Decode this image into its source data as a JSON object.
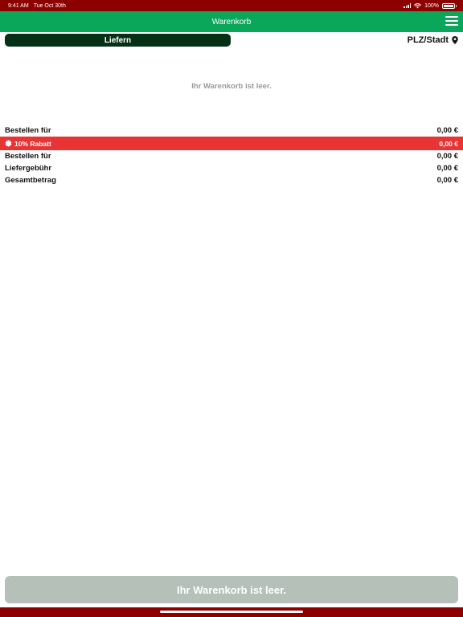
{
  "status_bar": {
    "time": "9:41 AM",
    "date": "Tue Oct 30th",
    "battery": "100%"
  },
  "header": {
    "title": "Warenkorb",
    "menu_icon": "hamburger-menu-icon"
  },
  "delivery": {
    "mode_label": "Liefern",
    "location_label": "PLZ/Stadt",
    "location_icon": "map-pin-icon"
  },
  "cart": {
    "empty_message": "Ihr Warenkorb ist leer."
  },
  "summary": {
    "order_for_1_label": "Bestellen für",
    "order_for_1_value": "0,00 €",
    "discount_label": "10% Rabatt",
    "discount_value": "0,00 €",
    "discount_icon": "discount-badge-icon",
    "order_for_2_label": "Bestellen für",
    "order_for_2_value": "0,00 €",
    "delivery_fee_label": "Liefergebühr",
    "delivery_fee_value": "0,00 €",
    "total_label": "Gesamtbetrag",
    "total_value": "0,00 €"
  },
  "checkout": {
    "label": "Ihr Warenkorb ist leer."
  },
  "colors": {
    "status_bar": "#8c0000",
    "nav_bar": "#0aa65a",
    "deliver_button": "#053016",
    "discount_bar": "#e83434",
    "checkout_disabled": "#b5c1b8"
  }
}
